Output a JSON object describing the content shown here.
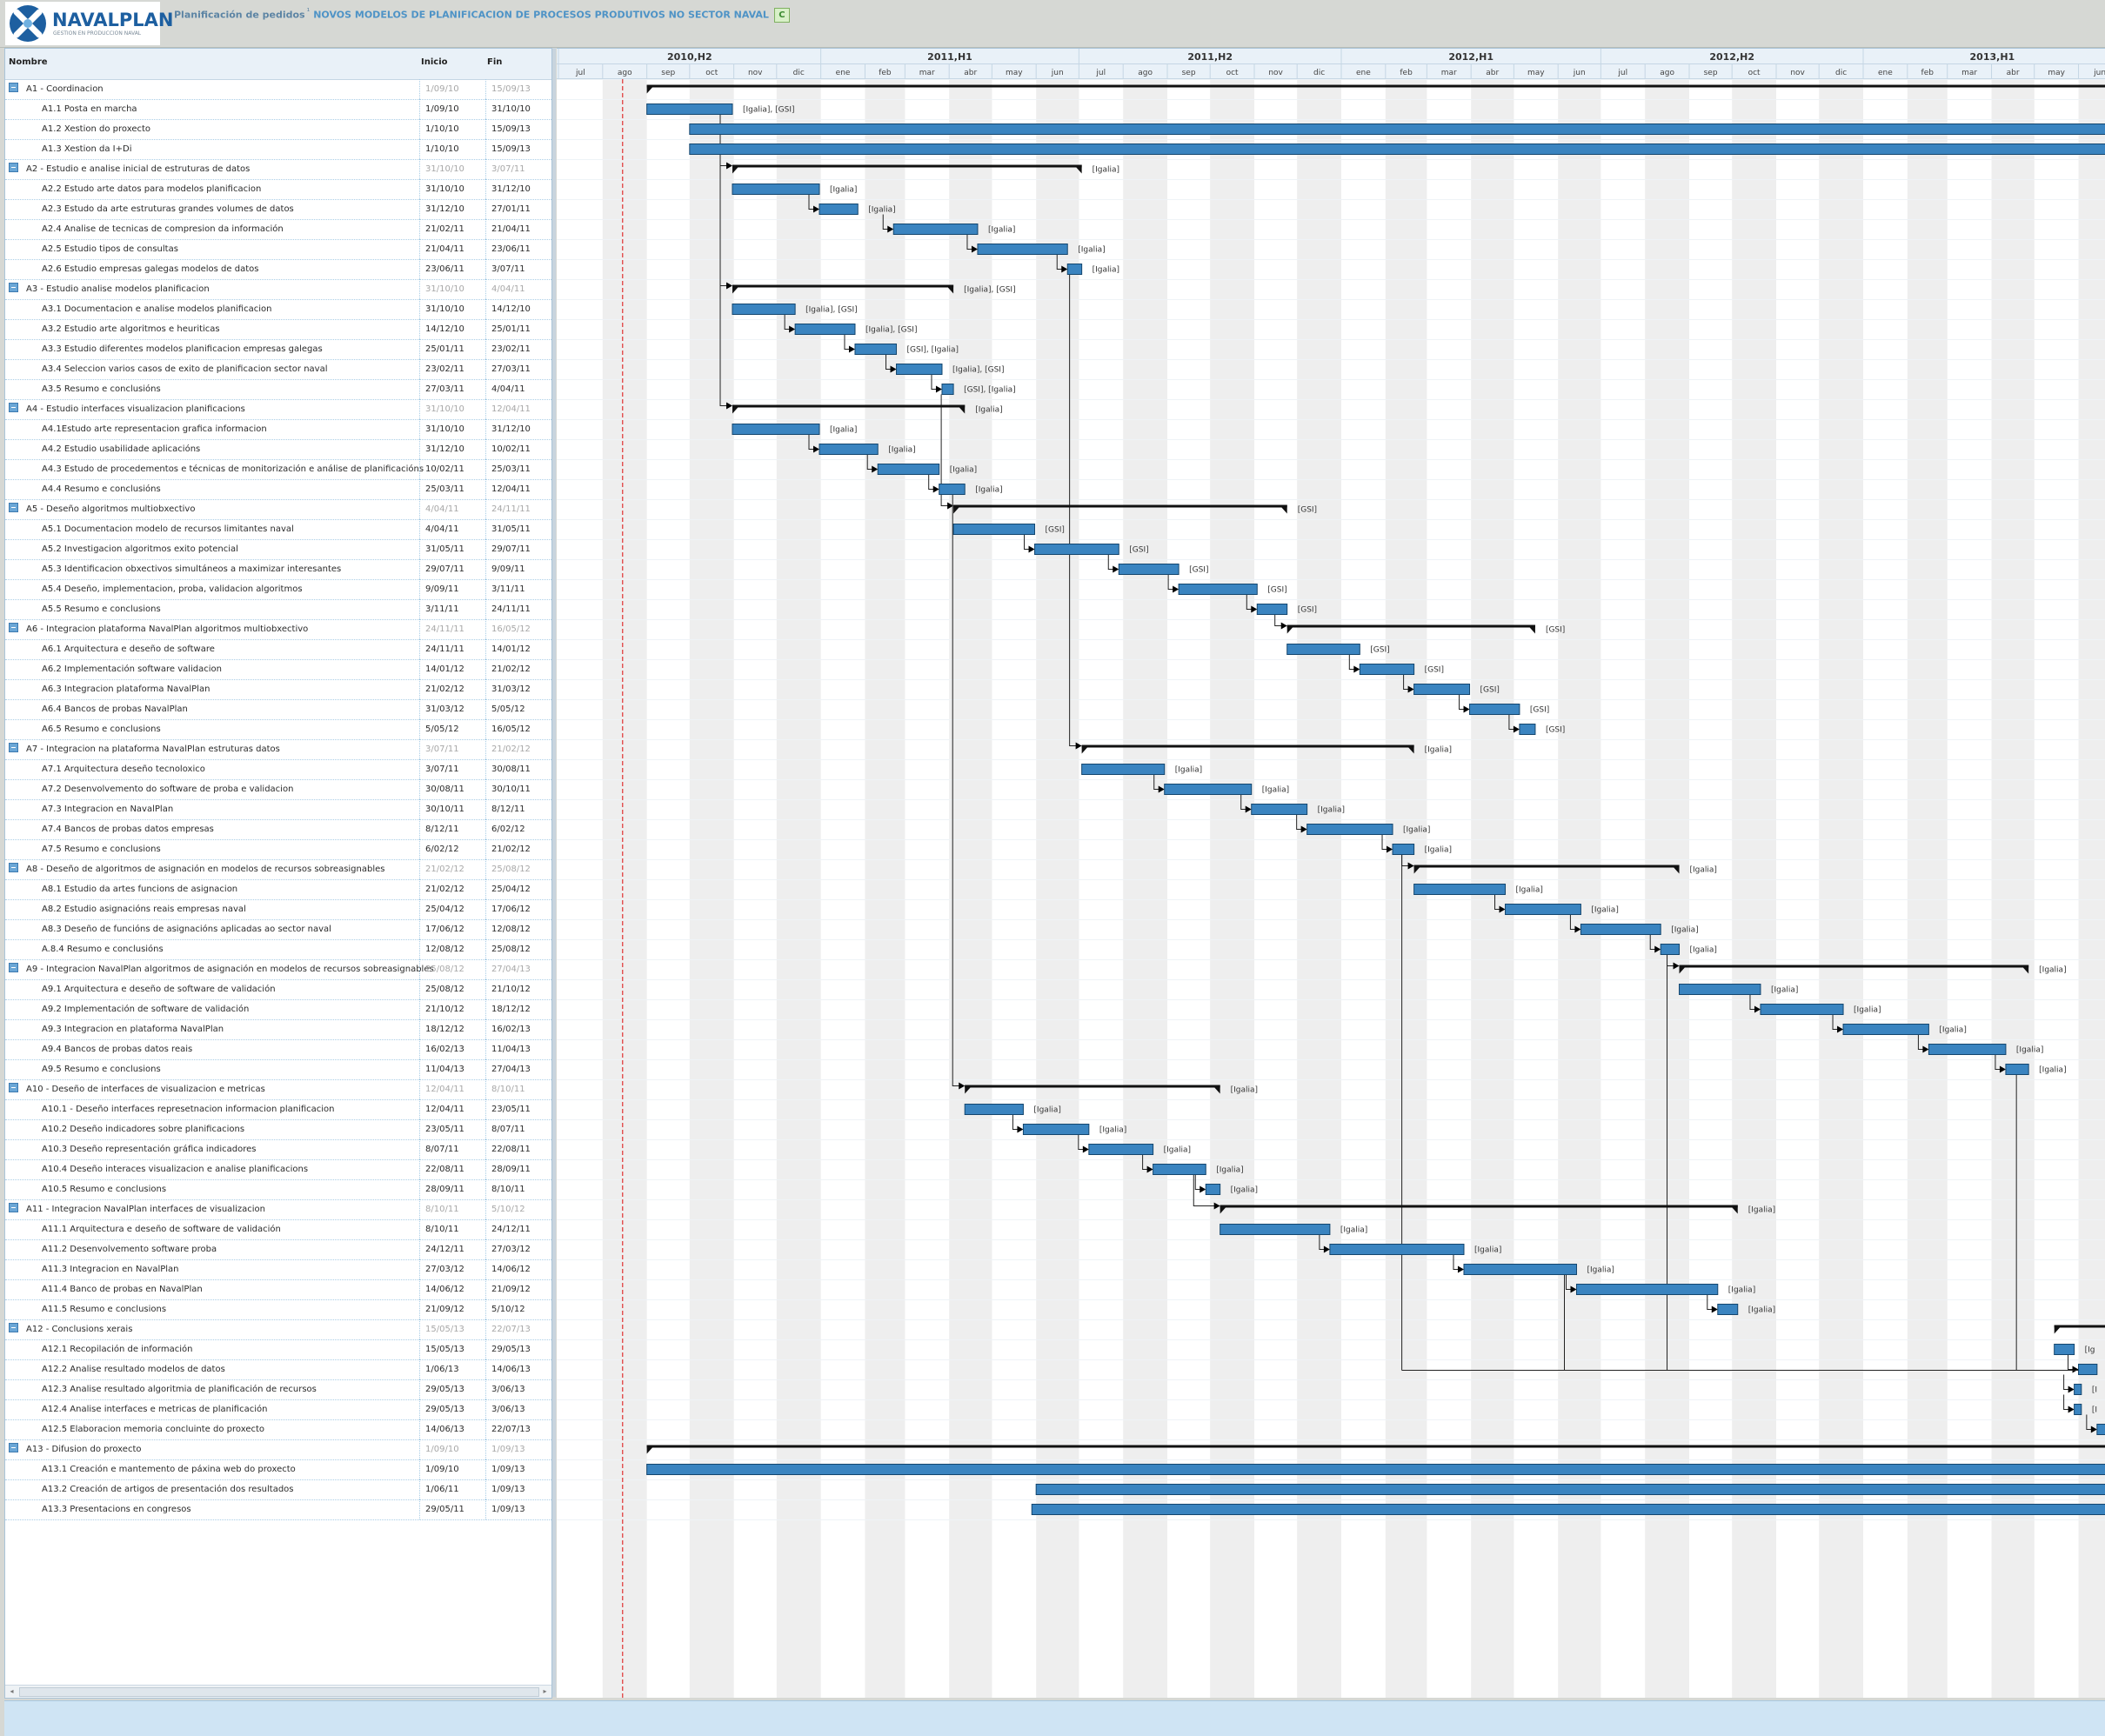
{
  "header": {
    "logo_name": "NAVALPLAN",
    "logo_tagline": "GESTION EN PRODUCCION NAVAL",
    "breadcrumb_section": "Planificación de pedidos",
    "breadcrumb_separator": "¹",
    "project_name": "NOVOS MODELOS DE PLANIFICACION DE PROCESOS PRODUTIVOS NO SECTOR NAVAL",
    "c_button": "C"
  },
  "columns": {
    "name": "Nombre",
    "start": "Inicio",
    "end": "Fin"
  },
  "timeline": {
    "halves": [
      "2010,H2",
      "2011,H1",
      "2011,H2",
      "2012,H1",
      "2012,H2",
      "2013,H1"
    ],
    "months": [
      "jul",
      "ago",
      "sep",
      "oct",
      "nov",
      "dic",
      "ene",
      "feb",
      "mar",
      "abr",
      "may",
      "jun",
      "jul",
      "ago",
      "sep",
      "oct",
      "nov",
      "dic",
      "ene",
      "feb",
      "mar",
      "abr",
      "may",
      "jun",
      "jul",
      "ago",
      "sep",
      "oct",
      "nov",
      "dic",
      "ene",
      "feb",
      "mar",
      "abr",
      "may",
      "jun"
    ],
    "timeline_start": "1/07/10",
    "today_line": "15/08/10"
  },
  "colors": {
    "bar": "#3a84c0",
    "bar_border": "#14466e",
    "weekend_band": "#eeeeee",
    "today": "#e03030"
  },
  "tasks": [
    {
      "name": "A1 - Coordinacion",
      "start": "1/09/10",
      "end": "15/09/13",
      "group": true,
      "res": ""
    },
    {
      "name": "A1.1 Posta en marcha",
      "start": "1/09/10",
      "end": "31/10/10",
      "group": false,
      "res": "[Igalia], [GSI]"
    },
    {
      "name": "A1.2 Xestion do proxecto",
      "start": "1/10/10",
      "end": "15/09/13",
      "group": false,
      "res": ""
    },
    {
      "name": "A1.3 Xestion da I+Di",
      "start": "1/10/10",
      "end": "15/09/13",
      "group": false,
      "res": ""
    },
    {
      "name": "A2 - Estudio e analise inicial de estruturas de datos",
      "start": "31/10/10",
      "end": "3/07/11",
      "group": true,
      "res": "[Igalia]"
    },
    {
      "name": "A2.2 Estudo arte datos para modelos planificacion",
      "start": "31/10/10",
      "end": "31/12/10",
      "group": false,
      "res": "[Igalia]"
    },
    {
      "name": "A2.3 Estudo da arte estruturas grandes volumes de datos",
      "start": "31/12/10",
      "end": "27/01/11",
      "group": false,
      "res": "[Igalia]"
    },
    {
      "name": "A2.4 Analise de tecnicas de compresion da información",
      "start": "21/02/11",
      "end": "21/04/11",
      "group": false,
      "res": "[Igalia]"
    },
    {
      "name": "A2.5 Estudio tipos de consultas",
      "start": "21/04/11",
      "end": "23/06/11",
      "group": false,
      "res": "[Igalia]"
    },
    {
      "name": "A2.6 Estudio empresas galegas modelos de datos",
      "start": "23/06/11",
      "end": "3/07/11",
      "group": false,
      "res": "[Igalia]"
    },
    {
      "name": "A3 - Estudio analise modelos planificacion",
      "start": "31/10/10",
      "end": "4/04/11",
      "group": true,
      "res": "[Igalia], [GSI]"
    },
    {
      "name": "A3.1 Documentacion e analise modelos planificacion",
      "start": "31/10/10",
      "end": "14/12/10",
      "group": false,
      "res": "[Igalia], [GSI]"
    },
    {
      "name": "A3.2 Estudio arte algoritmos e heuriticas",
      "start": "14/12/10",
      "end": "25/01/11",
      "group": false,
      "res": "[Igalia], [GSI]"
    },
    {
      "name": "A3.3 Estudio diferentes modelos planificacion empresas galegas",
      "start": "25/01/11",
      "end": "23/02/11",
      "group": false,
      "res": "[GSI], [Igalia]"
    },
    {
      "name": "A3.4 Seleccion varios casos de exito de planificacion sector naval",
      "start": "23/02/11",
      "end": "27/03/11",
      "group": false,
      "res": "[Igalia], [GSI]"
    },
    {
      "name": "A3.5 Resumo e conclusións",
      "start": "27/03/11",
      "end": "4/04/11",
      "group": false,
      "res": "[GSI], [Igalia]"
    },
    {
      "name": "A4 - Estudio interfaces visualizacion planificacions",
      "start": "31/10/10",
      "end": "12/04/11",
      "group": true,
      "res": "[Igalia]"
    },
    {
      "name": "A4.1Estudo arte representacion grafica informacion",
      "start": "31/10/10",
      "end": "31/12/10",
      "group": false,
      "res": "[Igalia]"
    },
    {
      "name": "A4.2 Estudio usabilidade aplicacións",
      "start": "31/12/10",
      "end": "10/02/11",
      "group": false,
      "res": "[Igalia]"
    },
    {
      "name": "A4.3 Estudo de procedementos e técnicas de monitorización e análise de planificacións",
      "start": "10/02/11",
      "end": "25/03/11",
      "group": false,
      "res": "[Igalia]"
    },
    {
      "name": "A4.4 Resumo e conclusións",
      "start": "25/03/11",
      "end": "12/04/11",
      "group": false,
      "res": "[Igalia]"
    },
    {
      "name": "A5 - Deseño algoritmos multiobxectivo",
      "start": "4/04/11",
      "end": "24/11/11",
      "group": true,
      "res": "[GSI]"
    },
    {
      "name": "A5.1 Documentacion modelo de recursos limitantes naval",
      "start": "4/04/11",
      "end": "31/05/11",
      "group": false,
      "res": "[GSI]"
    },
    {
      "name": "A5.2 Investigacion algoritmos exito potencial",
      "start": "31/05/11",
      "end": "29/07/11",
      "group": false,
      "res": "[GSI]"
    },
    {
      "name": "A5.3 Identificacion obxectivos simultáneos a maximizar interesantes",
      "start": "29/07/11",
      "end": "9/09/11",
      "group": false,
      "res": "[GSI]"
    },
    {
      "name": "A5.4 Deseño, implementacion, proba, validacion algoritmos",
      "start": "9/09/11",
      "end": "3/11/11",
      "group": false,
      "res": "[GSI]"
    },
    {
      "name": "A5.5 Resumo e conclusions",
      "start": "3/11/11",
      "end": "24/11/11",
      "group": false,
      "res": "[GSI]"
    },
    {
      "name": "A6 - Integracion plataforma NavalPlan algoritmos multiobxectivo",
      "start": "24/11/11",
      "end": "16/05/12",
      "group": true,
      "res": "[GSI]"
    },
    {
      "name": "A6.1 Arquitectura e deseño de software",
      "start": "24/11/11",
      "end": "14/01/12",
      "group": false,
      "res": "[GSI]"
    },
    {
      "name": "A6.2 Implementación software validacion",
      "start": "14/01/12",
      "end": "21/02/12",
      "group": false,
      "res": "[GSI]"
    },
    {
      "name": "A6.3 Integracion plataforma NavalPlan",
      "start": "21/02/12",
      "end": "31/03/12",
      "group": false,
      "res": "[GSI]"
    },
    {
      "name": "A6.4 Bancos de probas NavalPlan",
      "start": "31/03/12",
      "end": "5/05/12",
      "group": false,
      "res": "[GSI]"
    },
    {
      "name": "A6.5 Resumo e conclusions",
      "start": "5/05/12",
      "end": "16/05/12",
      "group": false,
      "res": "[GSI]"
    },
    {
      "name": "A7 -  Integracion na plataforma NavalPlan estruturas datos",
      "start": "3/07/11",
      "end": "21/02/12",
      "group": true,
      "res": "[Igalia]"
    },
    {
      "name": "A7.1 Arquitectura deseño tecnoloxico",
      "start": "3/07/11",
      "end": "30/08/11",
      "group": false,
      "res": "[Igalia]"
    },
    {
      "name": "A7.2 Desenvolvemento do software de proba e validacion",
      "start": "30/08/11",
      "end": "30/10/11",
      "group": false,
      "res": "[Igalia]"
    },
    {
      "name": "A7.3 Integracion en NavalPlan",
      "start": "30/10/11",
      "end": "8/12/11",
      "group": false,
      "res": "[Igalia]"
    },
    {
      "name": "A7.4 Bancos de probas datos empresas",
      "start": "8/12/11",
      "end": "6/02/12",
      "group": false,
      "res": "[Igalia]"
    },
    {
      "name": "A7.5 Resumo e conclusions",
      "start": "6/02/12",
      "end": "21/02/12",
      "group": false,
      "res": "[Igalia]"
    },
    {
      "name": "A8 - Deseño de algoritmos de asignación en modelos de recursos  sobreasignables",
      "start": "21/02/12",
      "end": "25/08/12",
      "group": true,
      "res": "[Igalia]"
    },
    {
      "name": "A8.1 Estudio da artes funcions de asignacion",
      "start": "21/02/12",
      "end": "25/04/12",
      "group": false,
      "res": "[Igalia]"
    },
    {
      "name": "A8.2 Estudio asignacións reais empresas naval",
      "start": "25/04/12",
      "end": "17/06/12",
      "group": false,
      "res": "[Igalia]"
    },
    {
      "name": "A8.3 Deseño de funcións de asignacións aplicadas ao sector naval",
      "start": "17/06/12",
      "end": "12/08/12",
      "group": false,
      "res": "[Igalia]"
    },
    {
      "name": "A.8.4 Resumo e conclusións",
      "start": "12/08/12",
      "end": "25/08/12",
      "group": false,
      "res": "[Igalia]"
    },
    {
      "name": "A9 - Integracion NavalPlan algoritmos de asignación en modelos de recursos sobreasignables",
      "start": "25/08/12",
      "end": "27/04/13",
      "group": true,
      "res": "[Igalia]"
    },
    {
      "name": "A9.1 Arquitectura e deseño de software de validación",
      "start": "25/08/12",
      "end": "21/10/12",
      "group": false,
      "res": "[Igalia]"
    },
    {
      "name": "A9.2 Implementación de software de validación",
      "start": "21/10/12",
      "end": "18/12/12",
      "group": false,
      "res": "[Igalia]"
    },
    {
      "name": "A9.3 Integracion en plataforma NavalPlan",
      "start": "18/12/12",
      "end": "16/02/13",
      "group": false,
      "res": "[Igalia]"
    },
    {
      "name": "A9.4 Bancos de probas datos reais",
      "start": "16/02/13",
      "end": "11/04/13",
      "group": false,
      "res": "[Igalia]"
    },
    {
      "name": "A9.5 Resumo e conclusions",
      "start": "11/04/13",
      "end": "27/04/13",
      "group": false,
      "res": "[Igalia]"
    },
    {
      "name": "A10 - Deseño de interfaces de visualizacion e metricas",
      "start": "12/04/11",
      "end": "8/10/11",
      "group": true,
      "res": "[Igalia]"
    },
    {
      "name": "A10.1 - Deseño interfaces represetnacion informacion planificacion",
      "start": "12/04/11",
      "end": "23/05/11",
      "group": false,
      "res": "[Igalia]"
    },
    {
      "name": "A10.2 Deseño indicadores sobre planificacions",
      "start": "23/05/11",
      "end": "8/07/11",
      "group": false,
      "res": "[Igalia]"
    },
    {
      "name": "A10.3 Deseño representación gráfica indicadores",
      "start": "8/07/11",
      "end": "22/08/11",
      "group": false,
      "res": "[Igalia]"
    },
    {
      "name": "A10.4 Deseño interaces visualizacion e analise planificacions",
      "start": "22/08/11",
      "end": "28/09/11",
      "group": false,
      "res": "[Igalia]"
    },
    {
      "name": "A10.5 Resumo e conclusions",
      "start": "28/09/11",
      "end": "8/10/11",
      "group": false,
      "res": "[Igalia]"
    },
    {
      "name": "A11 - Integracion NavalPlan interfaces de visualizacion",
      "start": "8/10/11",
      "end": "5/10/12",
      "group": true,
      "res": "[Igalia]"
    },
    {
      "name": "A11.1 Arquitectura e deseño de software de validación",
      "start": "8/10/11",
      "end": "24/12/11",
      "group": false,
      "res": "[Igalia]"
    },
    {
      "name": "A11.2 Desenvolvemento software proba",
      "start": "24/12/11",
      "end": "27/03/12",
      "group": false,
      "res": "[Igalia]"
    },
    {
      "name": "A11.3 Integracion en NavalPlan",
      "start": "27/03/12",
      "end": "14/06/12",
      "group": false,
      "res": "[Igalia]"
    },
    {
      "name": "A11.4 Banco de probas en NavalPlan",
      "start": "14/06/12",
      "end": "21/09/12",
      "group": false,
      "res": "[Igalia]"
    },
    {
      "name": "A11.5 Resumo e conclusions",
      "start": "21/09/12",
      "end": "5/10/12",
      "group": false,
      "res": "[Igalia]"
    },
    {
      "name": "A12 - Conclusions xerais",
      "start": "15/05/13",
      "end": "22/07/13",
      "group": true,
      "res": ""
    },
    {
      "name": "A12.1 Recopilación de información",
      "start": "15/05/13",
      "end": "29/05/13",
      "group": false,
      "res": "[Ig"
    },
    {
      "name": "A12.2 Analise resultado modelos de datos",
      "start": "1/06/13",
      "end": "14/06/13",
      "group": false,
      "res": ""
    },
    {
      "name": "A12.3 Analise resultado algoritmia de planificación de recursos",
      "start": "29/05/13",
      "end": "3/06/13",
      "group": false,
      "res": "[I"
    },
    {
      "name": "A12.4 Analise interfaces e metricas de planificación",
      "start": "29/05/13",
      "end": "3/06/13",
      "group": false,
      "res": "[I"
    },
    {
      "name": "A12.5 Elaboracion memoria concluinte do proxecto",
      "start": "14/06/13",
      "end": "22/07/13",
      "group": false,
      "res": ""
    },
    {
      "name": "A13 - Difusion do proxecto",
      "start": "1/09/10",
      "end": "1/09/13",
      "group": true,
      "res": ""
    },
    {
      "name": "A13.1 Creación e mantemento de páxina web do proxecto",
      "start": "1/09/10",
      "end": "1/09/13",
      "group": false,
      "res": ""
    },
    {
      "name": "A13.2 Creación de artigos de presentación dos resultados",
      "start": "1/06/11",
      "end": "1/09/13",
      "group": false,
      "res": ""
    },
    {
      "name": "A13.3 Presentacions en congresos",
      "start": "29/05/11",
      "end": "1/09/13",
      "group": false,
      "res": ""
    }
  ]
}
